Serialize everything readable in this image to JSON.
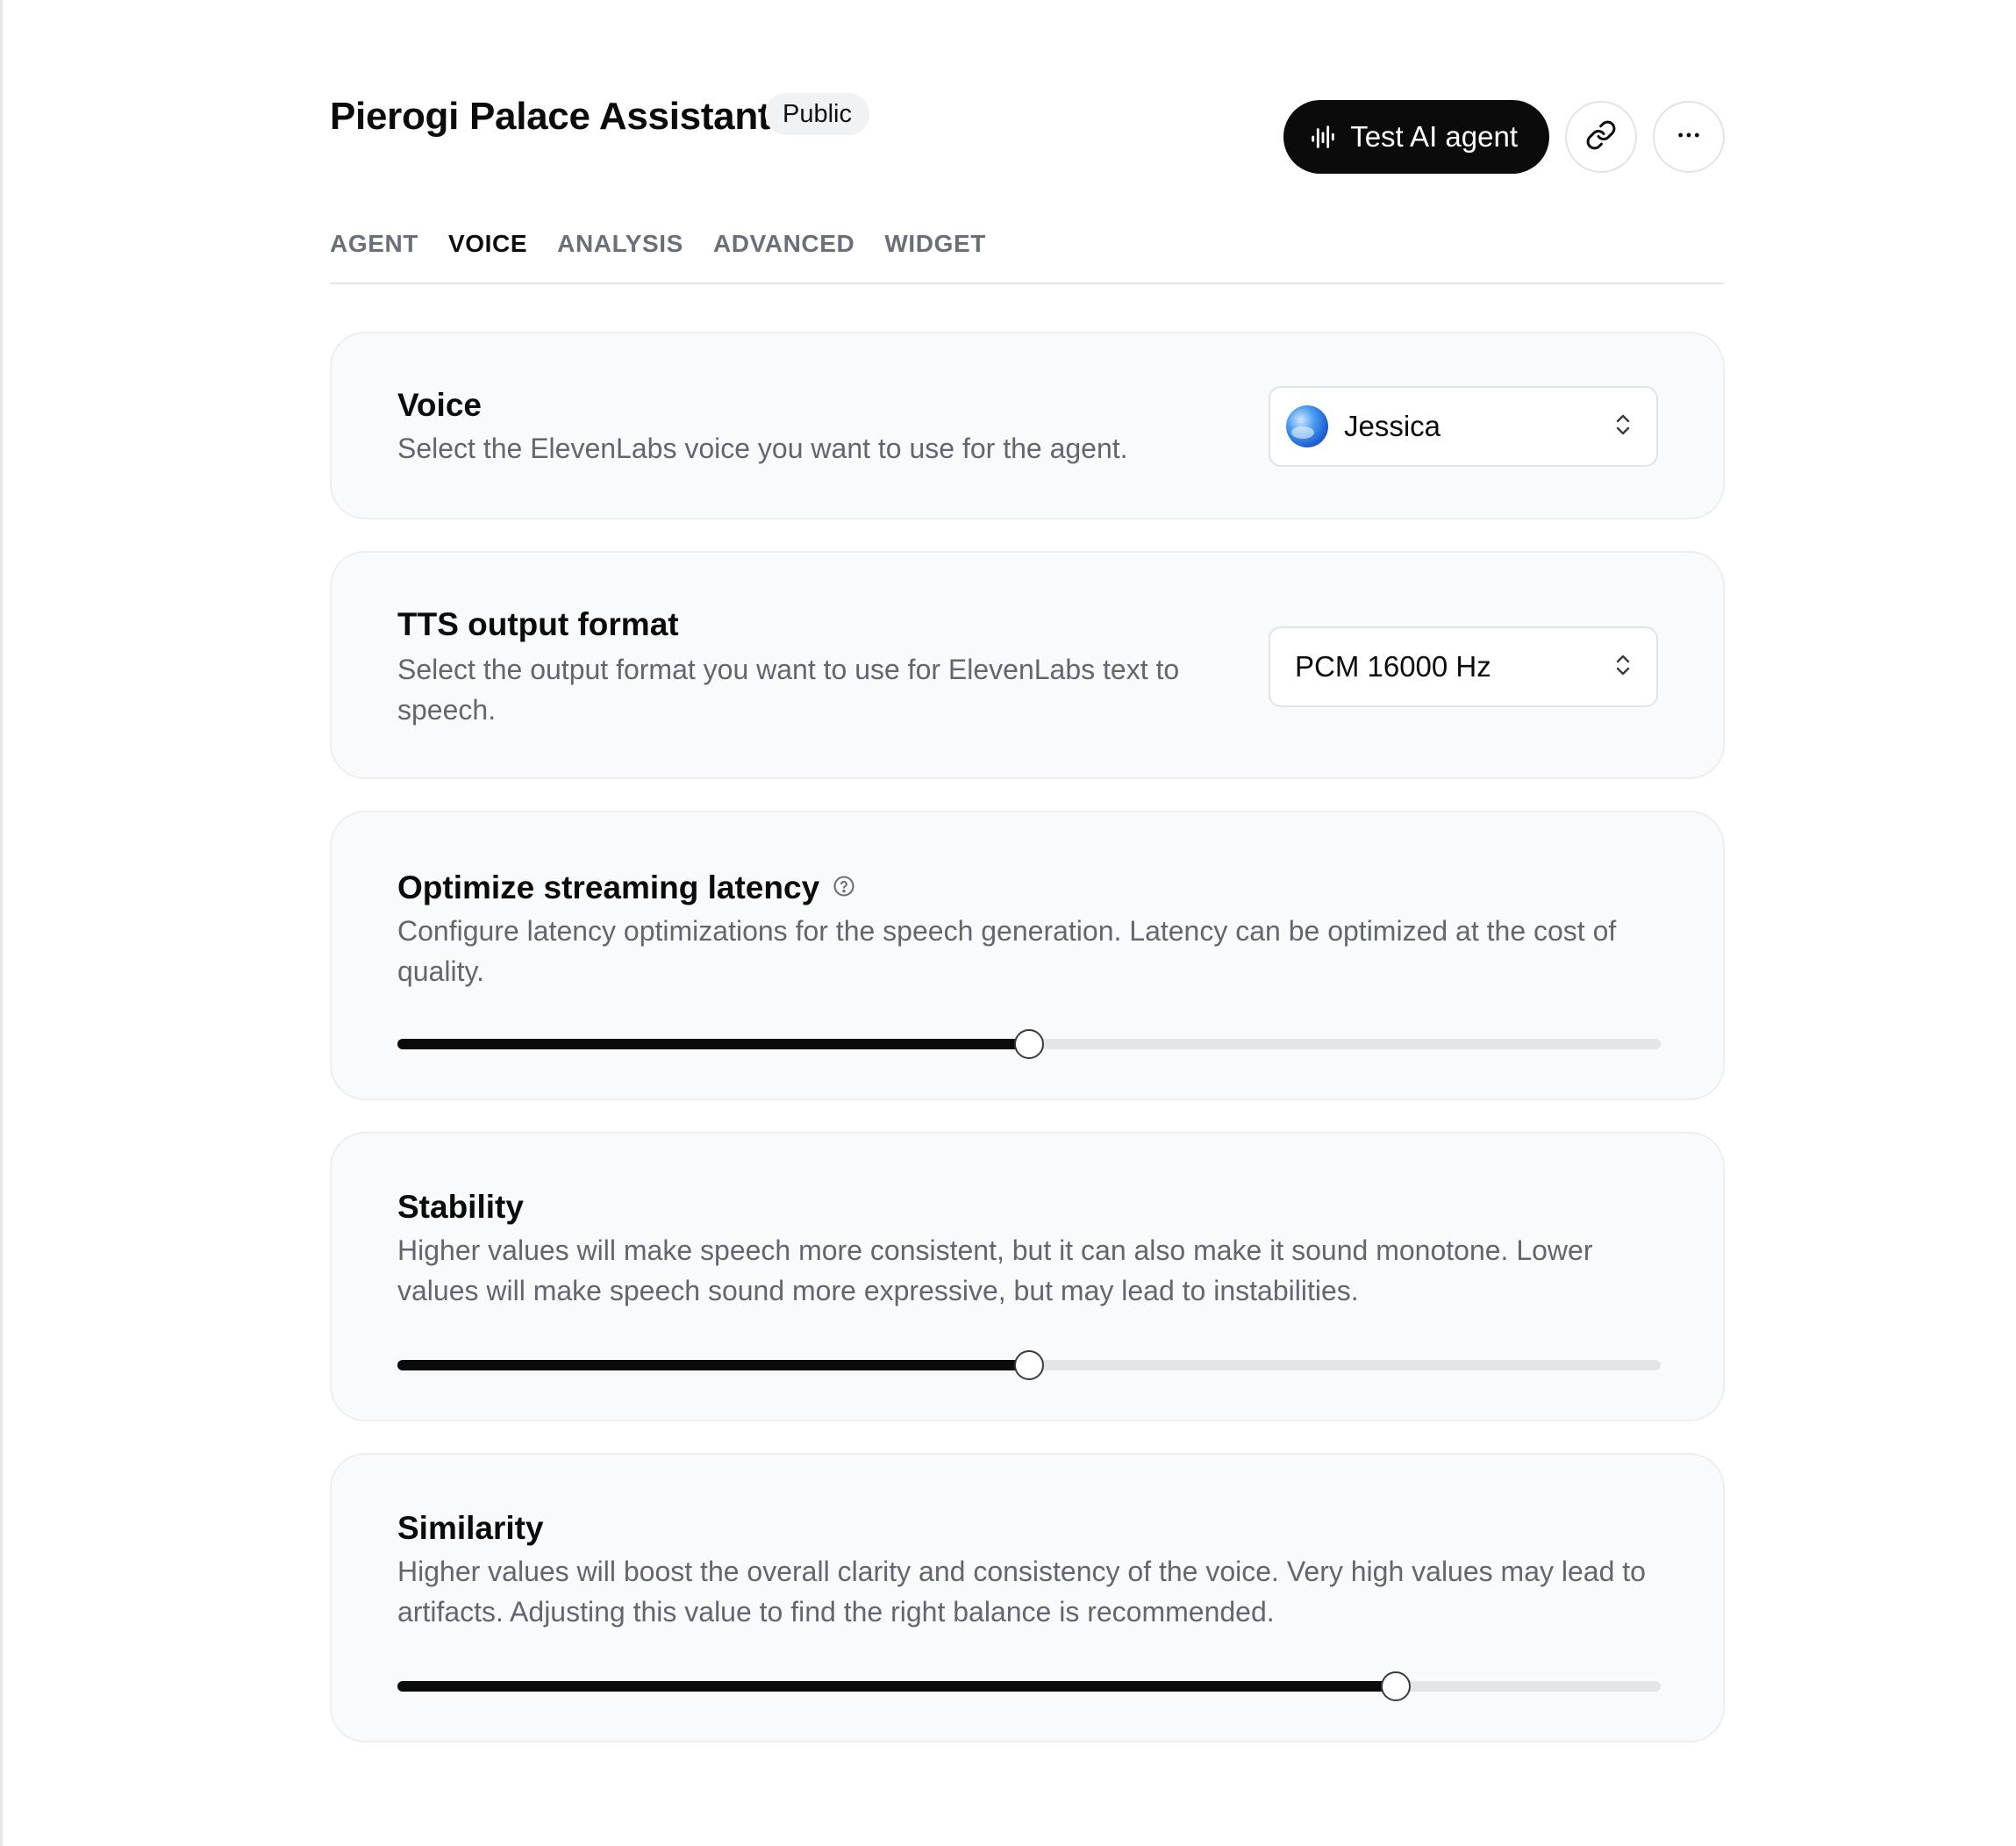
{
  "header": {
    "title": "Pierogi Palace Assistant",
    "badge": "Public",
    "test_button_label": "Test AI agent"
  },
  "tabs": [
    {
      "label": "AGENT",
      "active": false
    },
    {
      "label": "VOICE",
      "active": true
    },
    {
      "label": "ANALYSIS",
      "active": false
    },
    {
      "label": "ADVANCED",
      "active": false
    },
    {
      "label": "WIDGET",
      "active": false
    }
  ],
  "voice": {
    "title": "Voice",
    "description": "Select the ElevenLabs voice you want to use for the agent.",
    "selected": "Jessica"
  },
  "tts": {
    "title": "TTS output format",
    "description": "Select the output format you want to use for ElevenLabs text to speech.",
    "selected": "PCM 16000 Hz"
  },
  "latency": {
    "title": "Optimize streaming latency",
    "description": "Configure latency optimizations for the speech generation. Latency can be optimized at the cost of quality.",
    "value": 0.5
  },
  "stability": {
    "title": "Stability",
    "description": "Higher values will make speech more consistent, but it can also make it sound monotone. Lower values will make speech sound more expressive, but may lead to instabilities.",
    "value": 0.5
  },
  "similarity": {
    "title": "Similarity",
    "description": "Higher values will boost the overall clarity and consistency of the voice. Very high values may lead to artifacts. Adjusting this value to find the right balance is recommended.",
    "value": 0.79
  },
  "icons": {
    "test": "waveform-icon",
    "link": "link-icon",
    "more": "more-icon",
    "help": "help-circle-icon",
    "select": "chevron-up-down-icon"
  },
  "colors": {
    "primary": "#0b0b0b",
    "card_bg": "#f9fafb",
    "muted_text": "#62666f",
    "track": "#e4e5e8"
  }
}
